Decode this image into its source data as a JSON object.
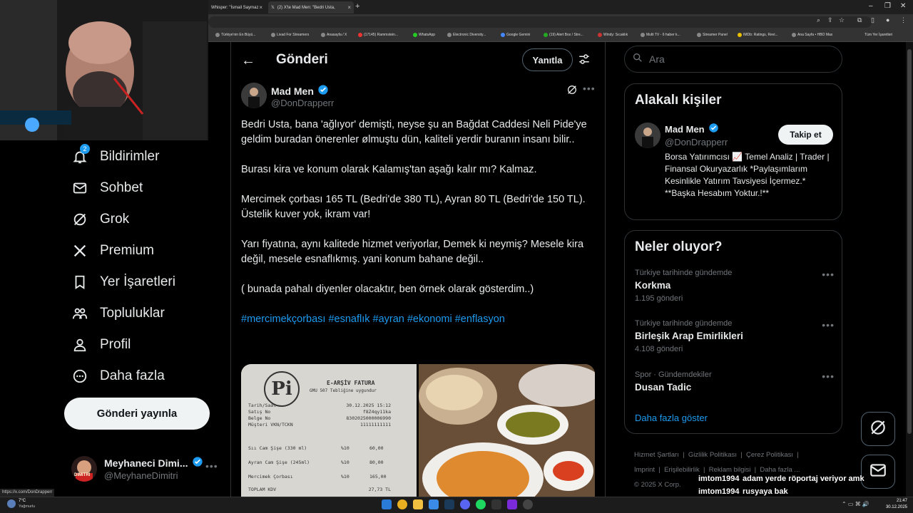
{
  "browser": {
    "tabs": [
      {
        "title": "Whisper: \"İsmail Saymaz",
        "active": false
      },
      {
        "title": "(2) X'te Mad Men: \"Bedri Usta,",
        "active": true
      }
    ],
    "bookmarks": [
      "Türkiye'nin En Büyü...",
      "Livad For Streamers",
      "Anasayfa / X",
      "(17145) Rammstein...",
      "WhatsApp",
      "Electronic Diversity...",
      "Google Gemini",
      "(19) Alert Box / Stre...",
      "Windy: Sıcaklık",
      "Multi TV - 6 haber k...",
      "Streamer Panel",
      "IMDb: Ratings, Revi...",
      "Ana Sayfa • HBO Max",
      "Tüm Yer İşaretleri"
    ]
  },
  "nav": {
    "items": [
      {
        "label": "Bildirimler",
        "icon": "bell-icon",
        "badge": "2"
      },
      {
        "label": "Sohbet",
        "icon": "mail-icon"
      },
      {
        "label": "Grok",
        "icon": "grok-icon"
      },
      {
        "label": "Premium",
        "icon": "x-logo-icon"
      },
      {
        "label": "Yer İşaretleri",
        "icon": "bookmark-icon"
      },
      {
        "label": "Topluluklar",
        "icon": "communities-icon"
      },
      {
        "label": "Profil",
        "icon": "person-icon"
      },
      {
        "label": "Daha fazla",
        "icon": "more-circle-icon"
      }
    ],
    "post_button": "Gönderi yayınla",
    "account": {
      "name": "Meyhaneci Dimi...",
      "handle": "@MeyhaneDimitri",
      "avatar_text": "DIMITRI"
    }
  },
  "header": {
    "title": "Gönderi",
    "reply_button": "Yanıtla"
  },
  "tweet": {
    "author": "Mad Men",
    "handle": "@DonDrapperr",
    "paragraphs": [
      "Bedri Usta, bana 'ağlıyor' demişti, neyse şu an Bağdat Caddesi Neli Pide'ye geldim buradan önerenler ølmuştu dün, kaliteli yerdir buranın insanı bilir..",
      "Burası kira ve konum olarak Kalamış'tan aşağı kalır mı? Kalmaz.",
      "Mercimek çorbası 165 TL (Bedri'de 380 TL), Ayran 80 TL (Bedri'de 150 TL).\nÜstelik kuver yok, ikram var!",
      "Yarı fiyatına, aynı kalitede hizmet veriyorlar, Demek ki neymiş? Mesele kira değil, mesele esnaflıkmış. yani konum bahane değil..",
      "( bunada pahalı diyenler olacaktır, ben örnek olarak gösterdim..)"
    ],
    "hashtags": [
      "#mercimekçorbası",
      "#esnaflık",
      "#ayran",
      "#ekonomi",
      "#enflasyon"
    ],
    "receipt": {
      "title": "E-ARŞİV FATURA",
      "subtitle": "GMU 507 Tebliğine uygundur",
      "rows": [
        {
          "label": "Tarih/Saat",
          "value": "30.12.2025 15:12"
        },
        {
          "label": "Satış No",
          "value": "f8Z4qy11ka"
        },
        {
          "label": "Belge No",
          "value": "8302025000006990"
        },
        {
          "label": "Müşteri VKN/TCKN",
          "value": "11111111111"
        }
      ],
      "items": [
        {
          "name": "Sıı Cam Şişe (330 ml)",
          "vat": "%10",
          "price": "60,00"
        },
        {
          "name": "Ayran Cam Şişe (245ml)",
          "vat": "%10",
          "price": "80,00"
        },
        {
          "name": "Mercimek Çorbası",
          "vat": "%10",
          "price": "165,00"
        }
      ],
      "total_label": "TOPLAM KDV",
      "total_value": "27,73 TL"
    }
  },
  "search": {
    "placeholder": "Ara"
  },
  "related": {
    "title": "Alakalı kişiler",
    "name": "Mad Men",
    "handle": "@DonDrapperr",
    "follow": "Takip et",
    "bio": "Borsa Yatırımcısı 📈 Temel Analiz | Trader | Finansal Okuryazarlık *Paylaşımlarım Kesinlikle Yatırım Tavsiyesi İçermez.* **Başka Hesabım Yoktur.!**"
  },
  "trends": {
    "title": "Neler oluyor?",
    "items": [
      {
        "context": "Türkiye tarihinde gündemde",
        "name": "Korkma",
        "count": "1.195 gönderi"
      },
      {
        "context": "Türkiye tarihinde gündemde",
        "name": "Birleşik Arap Emirlikleri",
        "count": "4.108 gönderi"
      },
      {
        "context": "Spor · Gündemdekiler",
        "name": "Dusan Tadic",
        "count": ""
      }
    ],
    "show_more": "Daha fazla göster"
  },
  "footer": {
    "links": [
      "Hizmet Şartları",
      "Gizlilik Politikası",
      "Çerez Politikası",
      "Imprint",
      "Erişilebilirlik",
      "Reklam bilgisi",
      "Daha fazla ..."
    ],
    "copyright": "© 2025 X Corp."
  },
  "chat": [
    {
      "user": "imtom1994",
      "msg": "adam yerde röportaj veriyor amk"
    },
    {
      "user": "imtom1994",
      "msg": "rusyaya bak"
    },
    {
      "user": "imtom1994",
      "msg": "🐷"
    }
  ],
  "status_url": "https://x.com/DonDrapperr",
  "taskbar": {
    "temp": "7°C",
    "weather": "Yağmurlu",
    "time": "21:47",
    "date": "30.12.2025"
  }
}
